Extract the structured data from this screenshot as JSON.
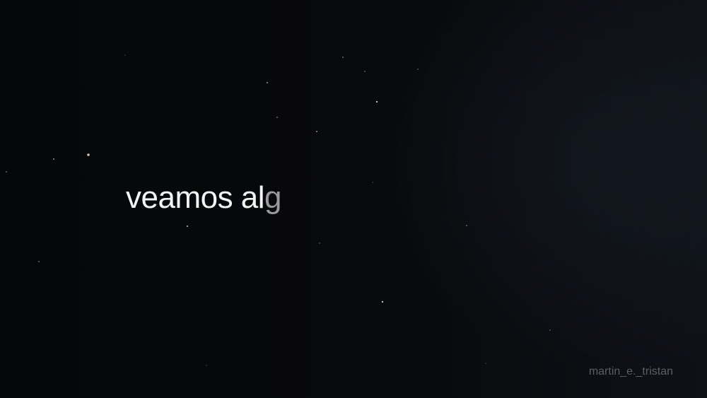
{
  "caption": {
    "solid_text": "veamos al",
    "fading_text": "g"
  },
  "watermark": {
    "text": "martin_e._tristan"
  },
  "colors": {
    "background": "#08090c",
    "caption_text": "#f4f4f4",
    "caption_fading_text": "#9a9a9a",
    "watermark_text": "#5b5e64",
    "star": "#d8d2c4"
  }
}
